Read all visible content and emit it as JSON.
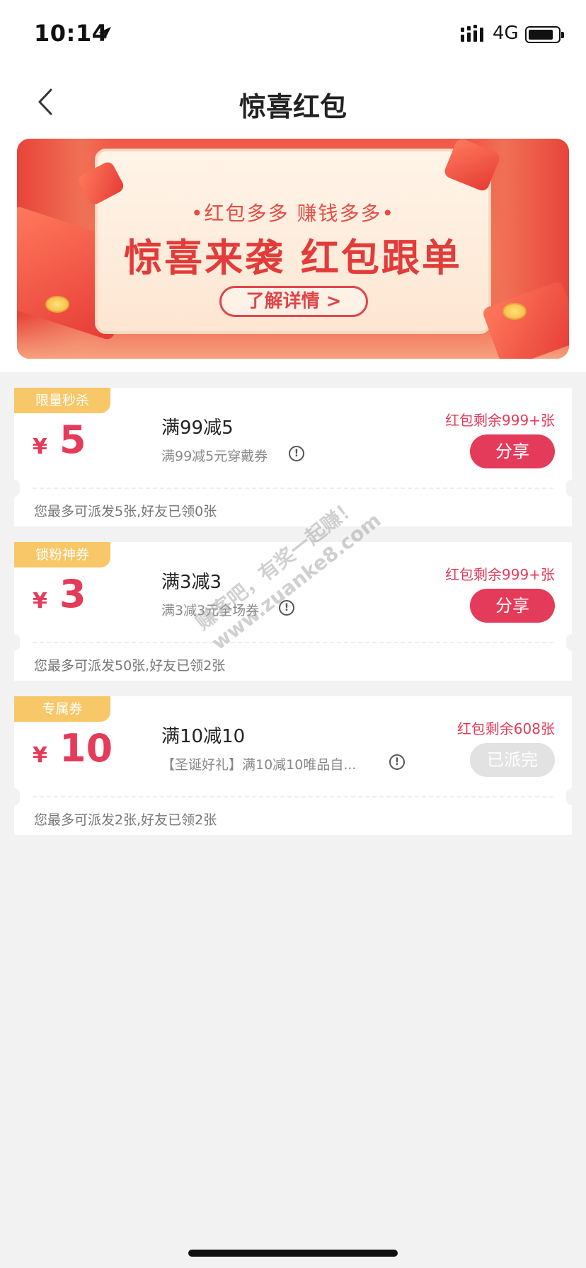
{
  "status_bar": {
    "time": "10:14",
    "network": "4G"
  },
  "nav": {
    "title": "惊喜红包"
  },
  "banner": {
    "subtitle": "•红包多多 赚钱多多•",
    "headline": "惊喜来袭 红包跟单",
    "detail_button": "了解详情 >"
  },
  "coupons": [
    {
      "tag": "限量秒杀",
      "currency": "¥",
      "amount": "5",
      "title": "满99减5",
      "desc": "满99减5元穿戴券",
      "remaining": "红包剩余999+张",
      "button": "分享",
      "footer": "您最多可派发5张,好友已领0张"
    },
    {
      "tag": "锁粉神券",
      "currency": "¥",
      "amount": "3",
      "title": "满3减3",
      "desc": "满3减3元全场券",
      "remaining": "红包剩余999+张",
      "button": "分享",
      "footer": "您最多可派发50张,好友已领2张"
    },
    {
      "tag": "专属券",
      "currency": "¥",
      "amount": "10",
      "title": "满10减10",
      "desc": "【圣诞好礼】满10减10唯品自...",
      "remaining": "红包剩余608张",
      "button": "已派完",
      "footer": "您最多可派发2张,好友已领2张"
    }
  ],
  "watermark": {
    "line1": "赚客吧，有奖一起赚！",
    "line2": "www.zuanke8.com"
  },
  "colors": {
    "accent": "#e53b5a",
    "tag": "#f7c768",
    "disabled": "#e2e2e2"
  }
}
